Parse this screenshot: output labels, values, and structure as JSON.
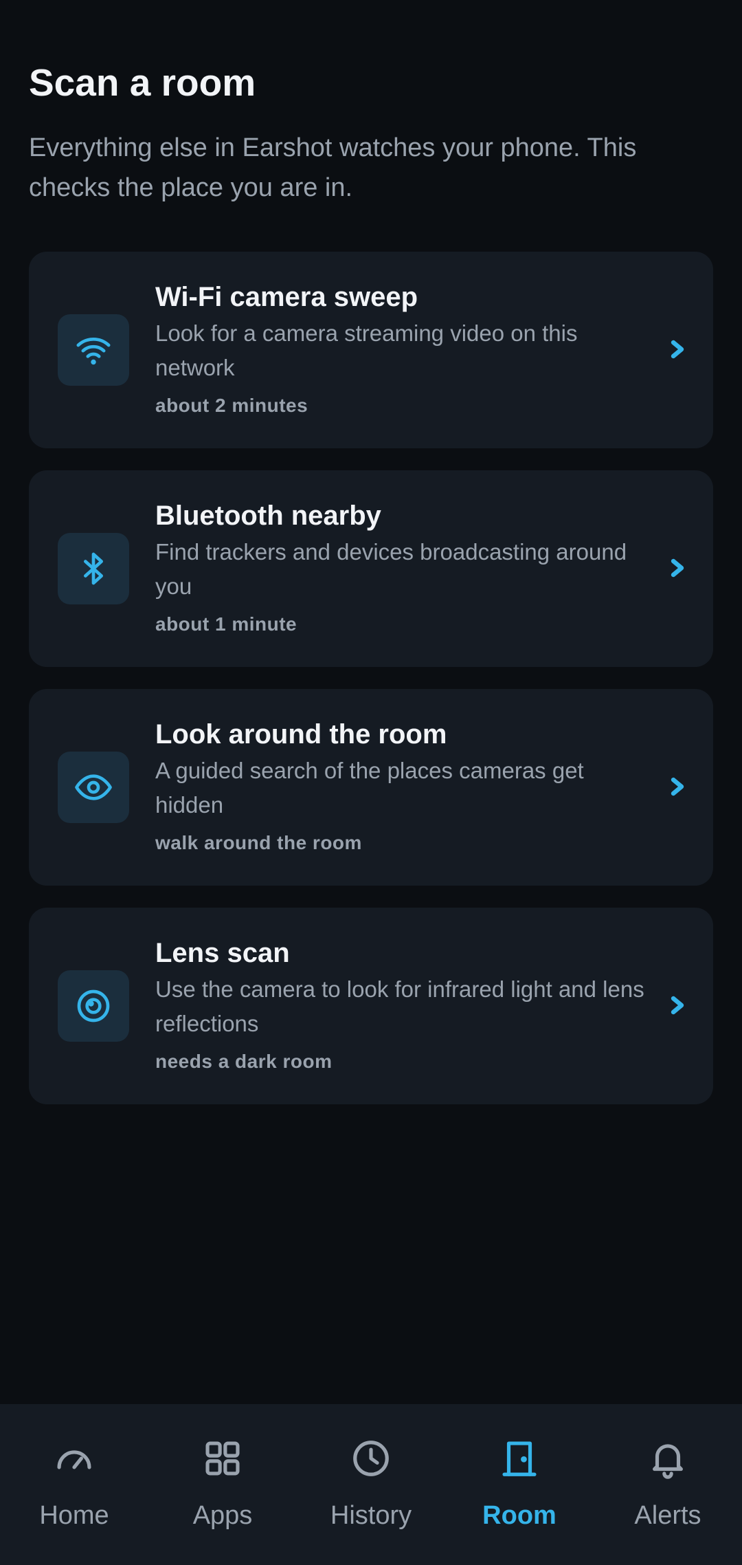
{
  "header": {
    "title": "Scan a room",
    "subtitle": "Everything else in Earshot watches your phone. This checks the place you are in."
  },
  "cards": [
    {
      "icon": "wifi-icon",
      "title": "Wi-Fi camera sweep",
      "description": "Look for a camera streaming video on this network",
      "meta": "about 2 minutes"
    },
    {
      "icon": "bluetooth-icon",
      "title": "Bluetooth nearby",
      "description": "Find trackers and devices broadcasting around you",
      "meta": "about 1 minute"
    },
    {
      "icon": "eye-icon",
      "title": "Look around the room",
      "description": "A guided search of the places cameras get hidden",
      "meta": "walk around the room"
    },
    {
      "icon": "lens-icon",
      "title": "Lens scan",
      "description": "Use the camera to look for infrared light and lens reflections",
      "meta": "needs a dark room"
    }
  ],
  "nav": {
    "items": [
      {
        "label": "Home",
        "icon": "speedometer-icon"
      },
      {
        "label": "Apps",
        "icon": "grid-icon"
      },
      {
        "label": "History",
        "icon": "clock-icon"
      },
      {
        "label": "Room",
        "icon": "door-icon",
        "active": true
      },
      {
        "label": "Alerts",
        "icon": "bell-icon"
      }
    ]
  },
  "colors": {
    "background": "#0b0e12",
    "card": "#151b23",
    "accent": "#35b4ea",
    "text_primary": "#f2f4f7",
    "text_secondary": "#9aa3ae"
  }
}
